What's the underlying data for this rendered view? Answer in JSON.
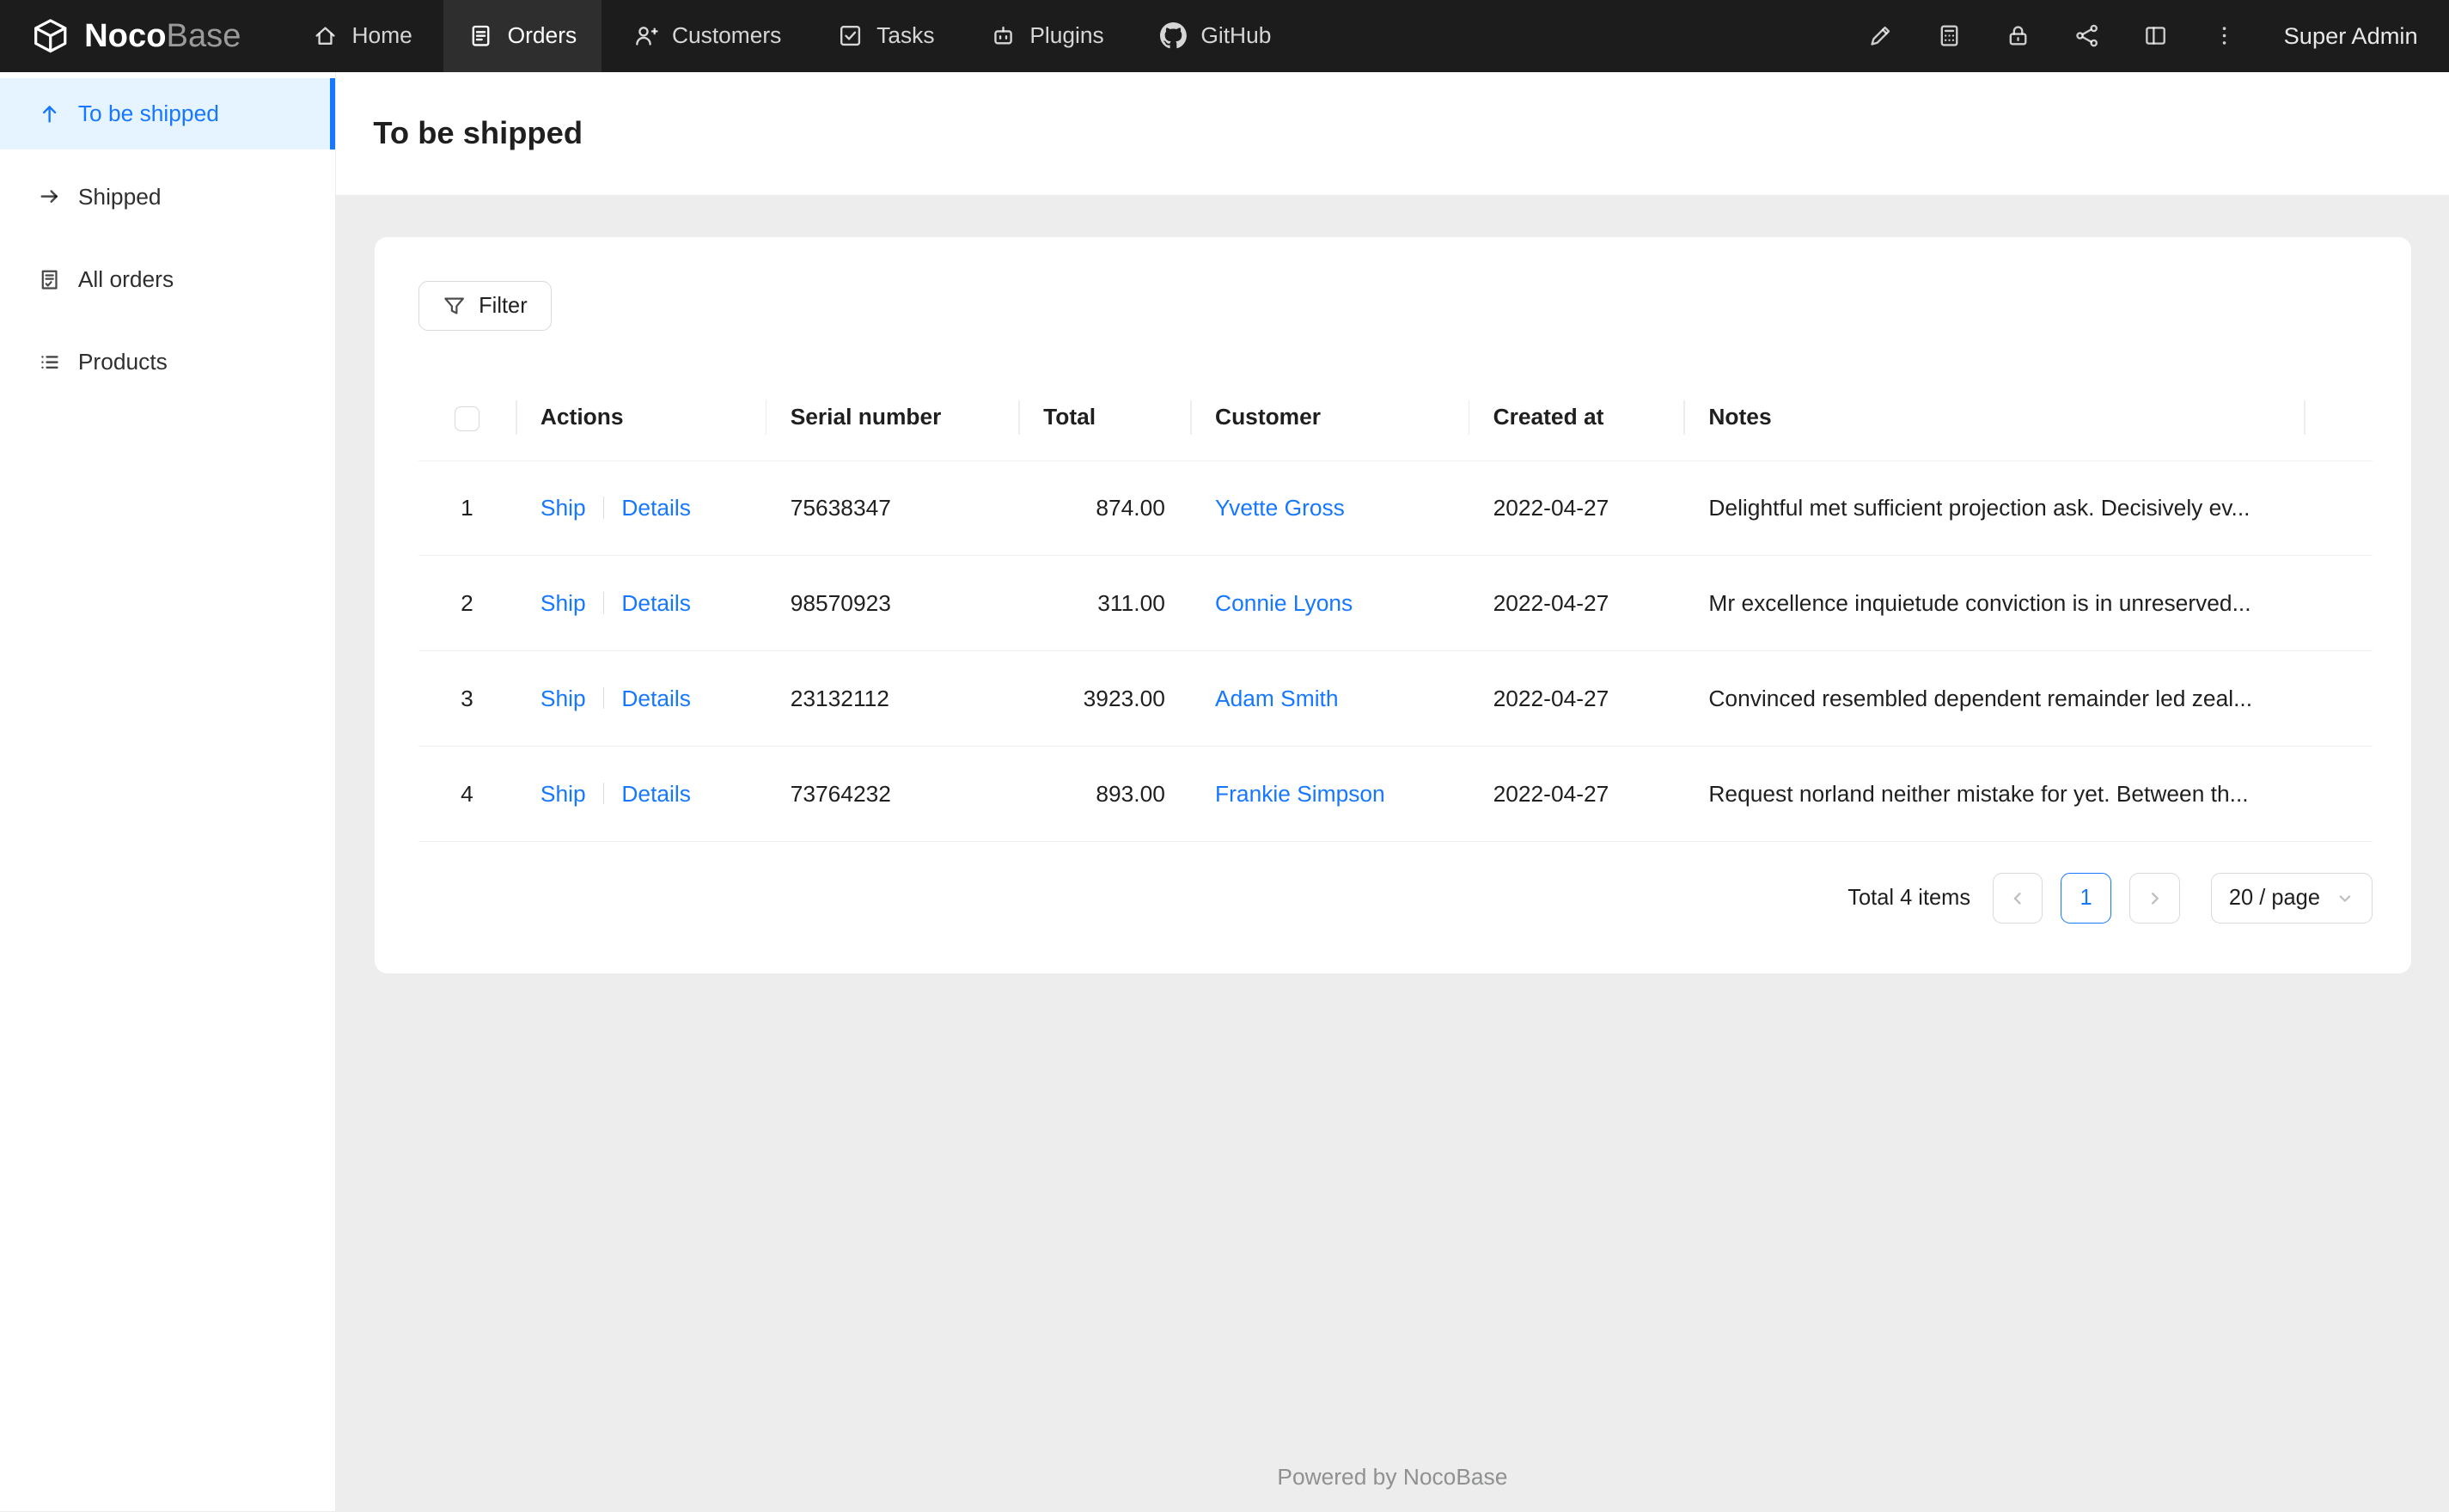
{
  "navbar": {
    "logo": {
      "name_bold": "Noco",
      "name_light": "Base"
    },
    "items": [
      {
        "label": "Home"
      },
      {
        "label": "Orders"
      },
      {
        "label": "Customers"
      },
      {
        "label": "Tasks"
      },
      {
        "label": "Plugins"
      },
      {
        "label": "GitHub"
      }
    ],
    "user": "Super Admin"
  },
  "sidebar": {
    "items": [
      {
        "label": "To be shipped"
      },
      {
        "label": "Shipped"
      },
      {
        "label": "All orders"
      },
      {
        "label": "Products"
      }
    ]
  },
  "page": {
    "title": "To be shipped"
  },
  "toolbar": {
    "filter_label": "Filter"
  },
  "table": {
    "columns": [
      "Actions",
      "Serial number",
      "Total",
      "Customer",
      "Created at",
      "Notes"
    ],
    "action_labels": {
      "ship": "Ship",
      "details": "Details"
    },
    "rows": [
      {
        "num": "1",
        "serial": "75638347",
        "total": "874.00",
        "customer": "Yvette Gross",
        "created_at": "2022-04-27",
        "notes": "Delightful met sufficient projection ask. Decisively ev..."
      },
      {
        "num": "2",
        "serial": "98570923",
        "total": "311.00",
        "customer": "Connie Lyons",
        "created_at": "2022-04-27",
        "notes": "Mr excellence inquietude conviction is in unreserved..."
      },
      {
        "num": "3",
        "serial": "23132112",
        "total": "3923.00",
        "customer": "Adam Smith",
        "created_at": "2022-04-27",
        "notes": "Convinced resembled dependent remainder led zeal..."
      },
      {
        "num": "4",
        "serial": "73764232",
        "total": "893.00",
        "customer": "Frankie Simpson",
        "created_at": "2022-04-27",
        "notes": "Request norland neither mistake for yet. Between th..."
      }
    ]
  },
  "pagination": {
    "total_text": "Total 4 items",
    "current_page": "1",
    "page_size": "20 / page"
  },
  "footer": {
    "text": "Powered by NocoBase"
  },
  "colors": {
    "accent": "#1677ff",
    "navbar_bg": "#1c1c1c",
    "sidebar_active_bg": "#e6f4ff"
  }
}
